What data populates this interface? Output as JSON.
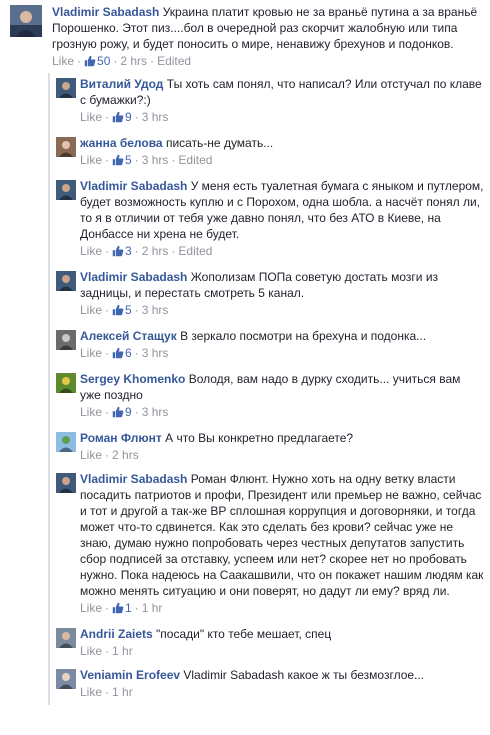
{
  "main_comment": {
    "author": "Vladimir Sabadash",
    "text": "Украина платит кровью не за враньё путина а за враньё Порошенко. Этот пиз....бол в очередной раз скорчит жалобную или типа грозную рожу, и будет поносить о мире, ненавижу брехунов и подонков.",
    "like_label": "Like",
    "likes": "50",
    "time": "2 hrs",
    "edited": "Edited",
    "avatar_icon": "user-photo-icon"
  },
  "replies": [
    {
      "author": "Виталий Удод",
      "text": "Ты хоть сам понял, что написал? Или отстучал по клаве с бумажки?:)",
      "like_label": "Like",
      "likes": "9",
      "time": "3 hrs",
      "edited": "",
      "avatar_icon": "user-photo-icon"
    },
    {
      "author": "жанна белова",
      "text": "писать-не думать...",
      "like_label": "Like",
      "likes": "5",
      "time": "3 hrs",
      "edited": "Edited",
      "avatar_icon": "user-photo-icon"
    },
    {
      "author": "Vladimir Sabadash",
      "text": "У меня есть туалетная бумага с яныком и путлером, будет возможность куплю и с Порохом, одна шобла. а насчёт понял ли, то я в отличии от тебя уже давно понял, что без АТО в Киеве, на Донбассе ни хрена не будет.",
      "like_label": "Like",
      "likes": "3",
      "time": "2 hrs",
      "edited": "Edited",
      "avatar_icon": "user-photo-icon"
    },
    {
      "author": "Vladimir Sabadash",
      "text": "Жополизам ПОПа советую достать мозги из задницы, и перестать смотреть 5 канал.",
      "like_label": "Like",
      "likes": "5",
      "time": "3 hrs",
      "edited": "",
      "avatar_icon": "user-photo-icon"
    },
    {
      "author": "Алексей Стащук",
      "text": "В зеркало посмотри на брехуна и подонка...",
      "like_label": "Like",
      "likes": "6",
      "time": "3 hrs",
      "edited": "",
      "avatar_icon": "user-photo-icon"
    },
    {
      "author": "Sergey Khomenko",
      "text": "Володя, вам надо в дурку сходить... учиться вам уже поздно",
      "like_label": "Like",
      "likes": "9",
      "time": "3 hrs",
      "edited": "",
      "avatar_icon": "user-photo-icon"
    },
    {
      "author": "Роман Флюнт",
      "text": "А что Вы конкретно предлагаете?",
      "like_label": "Like",
      "likes": "",
      "time": "2 hrs",
      "edited": "",
      "avatar_icon": "user-photo-icon"
    },
    {
      "author": "Vladimir Sabadash",
      "text": "Роман Флюнт. Нужно хоть на одну ветку власти посадить патриотов и профи, Президент или премьер не важно, сейчас и тот и другой а так-же ВР сплошная коррупция и договорняки, и тогда может что-то сдвинется. Как это сделать без крови? сейчас уже не знаю, думаю нужно попробовать через честных депутатов запустить сбор подписей за отставку, успеем или нет? скорее нет но пробовать нужно. Пока надеюсь на Саакашвили, что он покажет нашим людям как можно менять ситуацию и они поверят, но дадут ли ему? вряд ли.",
      "like_label": "Like",
      "likes": "1",
      "time": "1 hr",
      "edited": "",
      "avatar_icon": "user-photo-icon"
    },
    {
      "author": "Andrii Zaiets",
      "text": "\"посади\" кто тебе мешает, спец",
      "like_label": "Like",
      "likes": "",
      "time": "1 hr",
      "edited": "",
      "avatar_icon": "user-photo-icon"
    },
    {
      "author": "Veniamin Erofeev",
      "text": "Vladimir Sabadash какое ж ты безмозглое...",
      "like_label": "Like",
      "likes": "",
      "time": "1 hr",
      "edited": "",
      "avatar_icon": "user-photo-icon"
    }
  ],
  "colors": {
    "author": "#365899",
    "meta": "#90949c",
    "like_count": "#4267b2",
    "thread_line": "#dcdee3"
  }
}
